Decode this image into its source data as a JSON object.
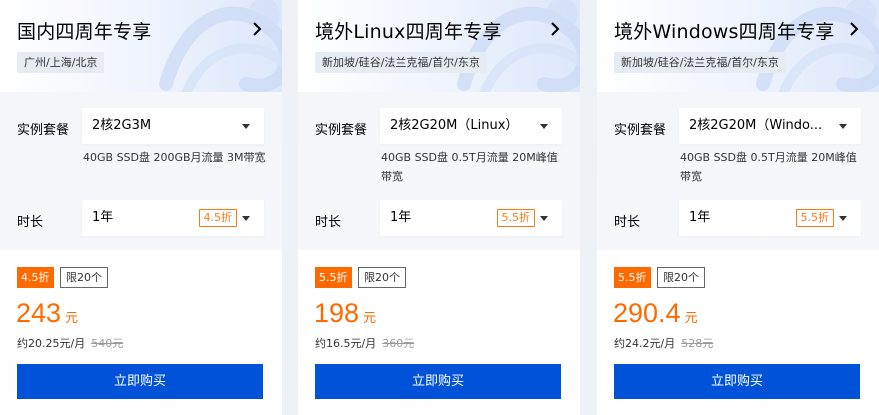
{
  "cards": [
    {
      "title": "国内四周年专享",
      "regions": "广州/上海/北京",
      "spec_label": "实例套餐",
      "spec_value": "2核2G3M",
      "spec_desc": "40GB SSD盘 200GB月流量 3M带宽",
      "duration_label": "时长",
      "duration_value": "1年",
      "duration_discount": "4.5折",
      "discount_badge": "4.5折",
      "limit_badge": "限20个",
      "price": "243",
      "price_unit": "元",
      "monthly": "约20.25元/月",
      "original_price": "540元",
      "buy_label": "立即购买"
    },
    {
      "title": "境外Linux四周年专享",
      "regions": "新加坡/硅谷/法兰克福/首尔/东京",
      "spec_label": "实例套餐",
      "spec_value": "2核2G20M（Linux）",
      "spec_desc": "40GB SSD盘 0.5T月流量 20M峰值带宽",
      "duration_label": "时长",
      "duration_value": "1年",
      "duration_discount": "5.5折",
      "discount_badge": "5.5折",
      "limit_badge": "限20个",
      "price": "198",
      "price_unit": "元",
      "monthly": "约16.5元/月",
      "original_price": "360元",
      "buy_label": "立即购买"
    },
    {
      "title": "境外Windows四周年专享",
      "regions": "新加坡/硅谷/法兰克福/首尔/东京",
      "spec_label": "实例套餐",
      "spec_value": "2核2G20M（Windo...",
      "spec_desc": "40GB SSD盘 0.5T月流量 20M峰值带宽",
      "duration_label": "时长",
      "duration_value": "1年",
      "duration_discount": "5.5折",
      "discount_badge": "5.5折",
      "limit_badge": "限20个",
      "price": "290.4",
      "price_unit": "元",
      "monthly": "约24.2元/月",
      "original_price": "528元",
      "buy_label": "立即购买"
    }
  ],
  "colors": {
    "accent_orange": "#ff6a00",
    "buy_blue": "#0052d9",
    "header_tint": "#dce7fb"
  },
  "icons": {
    "title_arrow": "chevron-right-icon",
    "dropdown": "caret-down-icon"
  }
}
